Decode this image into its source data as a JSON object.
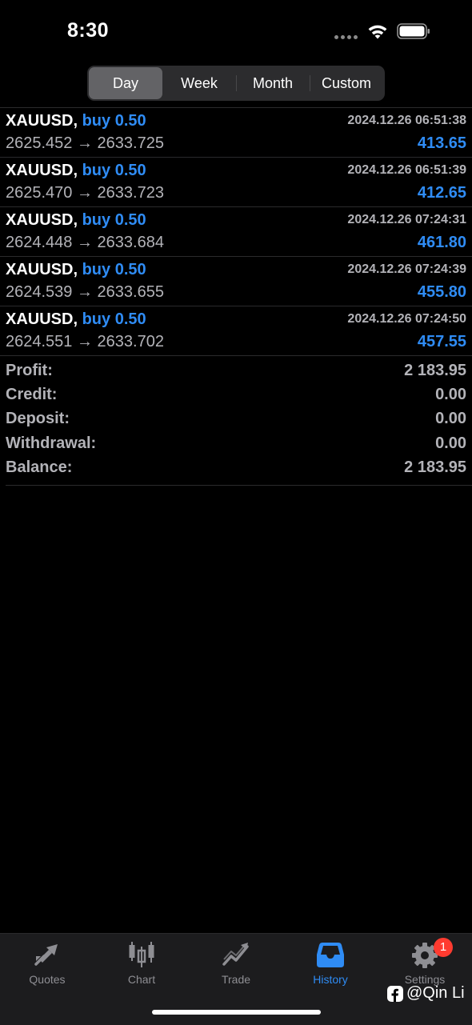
{
  "status_bar": {
    "time": "8:30"
  },
  "period_tabs": [
    {
      "label": "Day",
      "active": true
    },
    {
      "label": "Week",
      "active": false
    },
    {
      "label": "Month",
      "active": false
    },
    {
      "label": "Custom",
      "active": false
    }
  ],
  "deals": [
    {
      "symbol": "XAUUSD,",
      "side": "buy 0.50",
      "time": "2024.12.26 06:51:38",
      "prices": "2625.452 → 2633.725",
      "profit": "413.65"
    },
    {
      "symbol": "XAUUSD,",
      "side": "buy 0.50",
      "time": "2024.12.26 06:51:39",
      "prices": "2625.470 → 2633.723",
      "profit": "412.65"
    },
    {
      "symbol": "XAUUSD,",
      "side": "buy 0.50",
      "time": "2024.12.26 07:24:31",
      "prices": "2624.448 → 2633.684",
      "profit": "461.80"
    },
    {
      "symbol": "XAUUSD,",
      "side": "buy 0.50",
      "time": "2024.12.26 07:24:39",
      "prices": "2624.539 → 2633.655",
      "profit": "455.80"
    },
    {
      "symbol": "XAUUSD,",
      "side": "buy 0.50",
      "time": "2024.12.26 07:24:50",
      "prices": "2624.551 → 2633.702",
      "profit": "457.55"
    }
  ],
  "summary": [
    {
      "label": "Profit:",
      "value": "2 183.95"
    },
    {
      "label": "Credit:",
      "value": "0.00"
    },
    {
      "label": "Deposit:",
      "value": "0.00"
    },
    {
      "label": "Withdrawal:",
      "value": "0.00"
    },
    {
      "label": "Balance:",
      "value": "2 183.95"
    }
  ],
  "tab_bar": {
    "quotes": "Quotes",
    "chart": "Chart",
    "trade": "Trade",
    "history": "History",
    "settings": "Settings",
    "settings_badge": "1",
    "active": "history"
  },
  "watermark": "@Qin Li",
  "colors": {
    "accent": "#2f8cf5",
    "background": "#000000",
    "secondary_text": "#b3b3b8",
    "badge": "#ff3b30"
  }
}
